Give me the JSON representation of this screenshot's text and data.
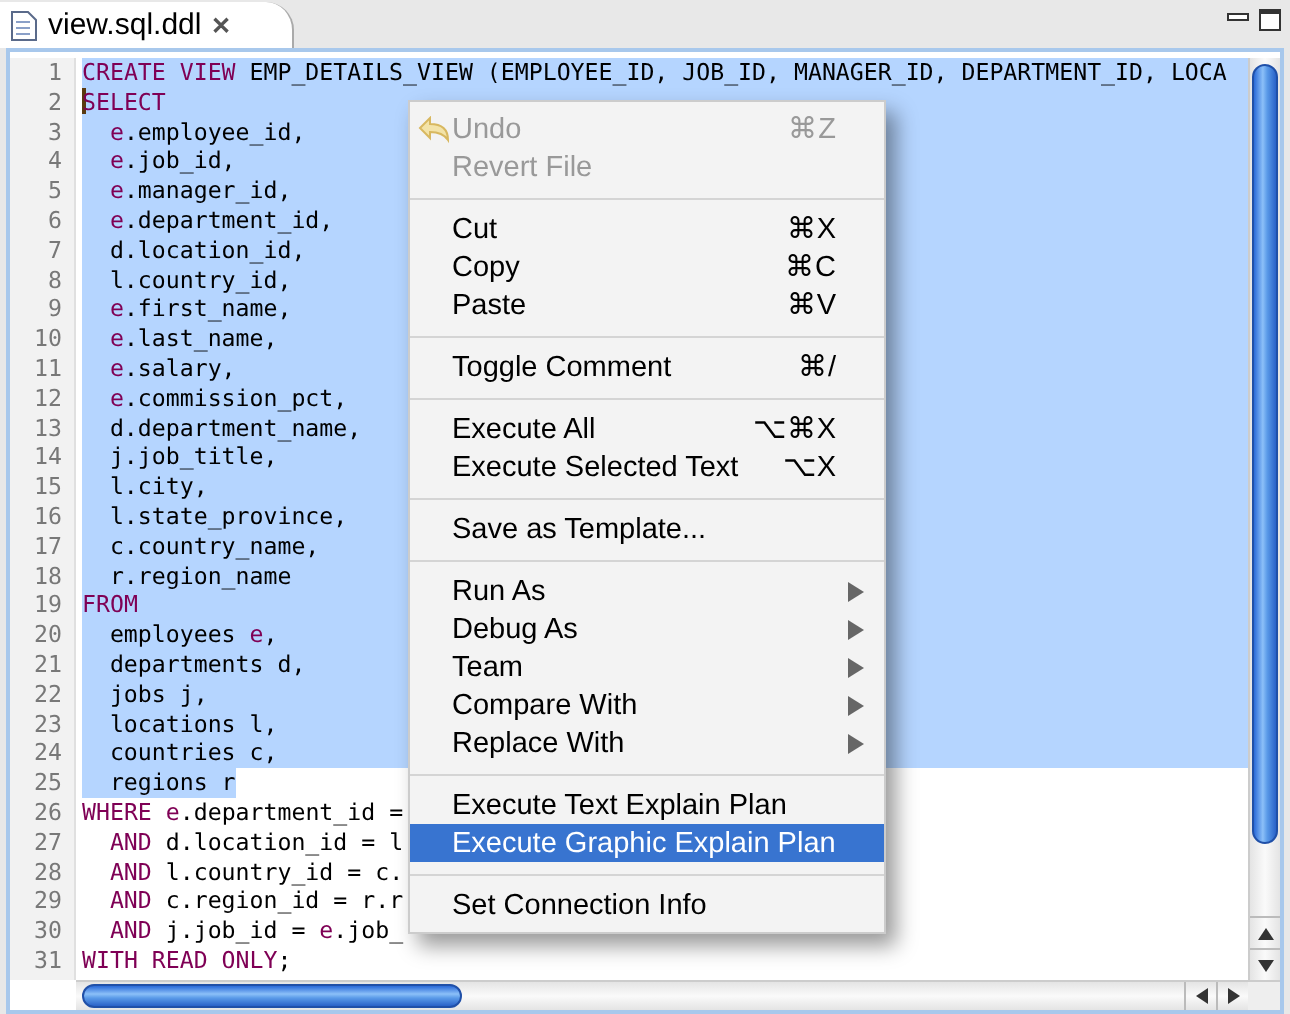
{
  "tab": {
    "title": "view.sql.ddl",
    "close": "✕"
  },
  "lines": [
    {
      "n": "1",
      "selected": true,
      "eol_selected": true,
      "indented": false,
      "tokens": [
        {
          "kind": "keyword",
          "text": "CREATE VIEW"
        },
        {
          "kind": "plain",
          "text": " EMP_DETAILS_VIEW (EMPLOYEE_ID, JOB_ID, MANAGER_ID, DEPARTMENT_ID, LOCA"
        }
      ]
    },
    {
      "n": "2",
      "selected": true,
      "eol_selected": true,
      "indented": false,
      "cursor": true,
      "tokens": [
        {
          "kind": "keyword",
          "text": "SELECT"
        }
      ]
    },
    {
      "n": "3",
      "selected": true,
      "eol_selected": true,
      "indented": true,
      "tokens": [
        {
          "kind": "alias",
          "text": "e"
        },
        {
          "kind": "plain",
          "text": ".employee_id,"
        }
      ]
    },
    {
      "n": "4",
      "selected": true,
      "eol_selected": true,
      "indented": true,
      "tokens": [
        {
          "kind": "alias",
          "text": "e"
        },
        {
          "kind": "plain",
          "text": ".job_id,"
        }
      ]
    },
    {
      "n": "5",
      "selected": true,
      "eol_selected": true,
      "indented": true,
      "tokens": [
        {
          "kind": "alias",
          "text": "e"
        },
        {
          "kind": "plain",
          "text": ".manager_id,"
        }
      ]
    },
    {
      "n": "6",
      "selected": true,
      "eol_selected": true,
      "indented": true,
      "tokens": [
        {
          "kind": "alias",
          "text": "e"
        },
        {
          "kind": "plain",
          "text": ".department_id,"
        }
      ]
    },
    {
      "n": "7",
      "selected": true,
      "eol_selected": true,
      "indented": true,
      "tokens": [
        {
          "kind": "plain",
          "text": "d.location_id,"
        }
      ]
    },
    {
      "n": "8",
      "selected": true,
      "eol_selected": true,
      "indented": true,
      "tokens": [
        {
          "kind": "plain",
          "text": "l.country_id,"
        }
      ]
    },
    {
      "n": "9",
      "selected": true,
      "eol_selected": true,
      "indented": true,
      "tokens": [
        {
          "kind": "alias",
          "text": "e"
        },
        {
          "kind": "plain",
          "text": ".first_name,"
        }
      ]
    },
    {
      "n": "10",
      "selected": true,
      "eol_selected": true,
      "indented": true,
      "tokens": [
        {
          "kind": "alias",
          "text": "e"
        },
        {
          "kind": "plain",
          "text": ".last_name,"
        }
      ]
    },
    {
      "n": "11",
      "selected": true,
      "eol_selected": true,
      "indented": true,
      "tokens": [
        {
          "kind": "alias",
          "text": "e"
        },
        {
          "kind": "plain",
          "text": ".salary,"
        }
      ]
    },
    {
      "n": "12",
      "selected": true,
      "eol_selected": true,
      "indented": true,
      "tokens": [
        {
          "kind": "alias",
          "text": "e"
        },
        {
          "kind": "plain",
          "text": ".commission_pct,"
        }
      ]
    },
    {
      "n": "13",
      "selected": true,
      "eol_selected": true,
      "indented": true,
      "tokens": [
        {
          "kind": "plain",
          "text": "d.department_name,"
        }
      ]
    },
    {
      "n": "14",
      "selected": true,
      "eol_selected": true,
      "indented": true,
      "tokens": [
        {
          "kind": "plain",
          "text": "j.job_title,"
        }
      ]
    },
    {
      "n": "15",
      "selected": true,
      "eol_selected": true,
      "indented": true,
      "tokens": [
        {
          "kind": "plain",
          "text": "l.city,"
        }
      ]
    },
    {
      "n": "16",
      "selected": true,
      "eol_selected": true,
      "indented": true,
      "tokens": [
        {
          "kind": "plain",
          "text": "l.state_province,"
        }
      ]
    },
    {
      "n": "17",
      "selected": true,
      "eol_selected": true,
      "indented": true,
      "tokens": [
        {
          "kind": "plain",
          "text": "c.country_name,"
        }
      ]
    },
    {
      "n": "18",
      "selected": true,
      "eol_selected": true,
      "indented": true,
      "tokens": [
        {
          "kind": "plain",
          "text": "r.region_name"
        }
      ]
    },
    {
      "n": "19",
      "selected": true,
      "eol_selected": true,
      "indented": false,
      "tokens": [
        {
          "kind": "keyword",
          "text": "FROM"
        }
      ]
    },
    {
      "n": "20",
      "selected": true,
      "eol_selected": true,
      "indented": true,
      "tokens": [
        {
          "kind": "plain",
          "text": "employees"
        },
        {
          "kind": "alias",
          "text": " e"
        },
        {
          "kind": "plain",
          "text": ","
        }
      ]
    },
    {
      "n": "21",
      "selected": true,
      "eol_selected": true,
      "indented": true,
      "tokens": [
        {
          "kind": "plain",
          "text": "departments d,"
        }
      ]
    },
    {
      "n": "22",
      "selected": true,
      "eol_selected": true,
      "indented": true,
      "tokens": [
        {
          "kind": "plain",
          "text": "jobs j,"
        }
      ]
    },
    {
      "n": "23",
      "selected": true,
      "eol_selected": true,
      "indented": true,
      "tokens": [
        {
          "kind": "plain",
          "text": "locations l,"
        }
      ]
    },
    {
      "n": "24",
      "selected": true,
      "eol_selected": true,
      "indented": true,
      "tokens": [
        {
          "kind": "plain",
          "text": "countries c,"
        }
      ]
    },
    {
      "n": "25",
      "selected": true,
      "eol_selected": false,
      "indented": true,
      "tokens": [
        {
          "kind": "plain",
          "text": "regions r"
        }
      ]
    },
    {
      "n": "26",
      "selected": false,
      "indented": false,
      "tokens": [
        {
          "kind": "keyword",
          "text": "WHERE"
        },
        {
          "kind": "alias",
          "text": " e"
        },
        {
          "kind": "plain",
          "text": ".department_id ="
        }
      ]
    },
    {
      "n": "27",
      "selected": false,
      "indented": true,
      "tokens": [
        {
          "kind": "keyword",
          "text": "AND"
        },
        {
          "kind": "plain",
          "text": " d.location_id = l"
        }
      ]
    },
    {
      "n": "28",
      "selected": false,
      "indented": true,
      "tokens": [
        {
          "kind": "keyword",
          "text": "AND"
        },
        {
          "kind": "plain",
          "text": " l.country_id = c."
        }
      ]
    },
    {
      "n": "29",
      "selected": false,
      "indented": true,
      "tokens": [
        {
          "kind": "keyword",
          "text": "AND"
        },
        {
          "kind": "plain",
          "text": " c.region_id = r.r"
        }
      ]
    },
    {
      "n": "30",
      "selected": false,
      "indented": true,
      "tokens": [
        {
          "kind": "keyword",
          "text": "AND"
        },
        {
          "kind": "plain",
          "text": " j.job_id ="
        },
        {
          "kind": "alias",
          "text": " e"
        },
        {
          "kind": "plain",
          "text": ".job_"
        }
      ]
    },
    {
      "n": "31",
      "selected": false,
      "indented": false,
      "tokens": [
        {
          "kind": "keyword",
          "text": "WITH READ ONLY"
        },
        {
          "kind": "plain",
          "text": ";"
        }
      ]
    }
  ],
  "context_menu": [
    {
      "kind": "item",
      "label": "Undo",
      "shortcut": "⌘Z",
      "disabled": true,
      "icon": true,
      "submenu": false,
      "selected": false
    },
    {
      "kind": "item",
      "label": "Revert File",
      "disabled": true,
      "submenu": false,
      "selected": false
    },
    {
      "kind": "separator"
    },
    {
      "kind": "item",
      "label": "Cut",
      "shortcut": "⌘X",
      "disabled": false,
      "submenu": false,
      "selected": false
    },
    {
      "kind": "item",
      "label": "Copy",
      "shortcut": "⌘C",
      "disabled": false,
      "submenu": false,
      "selected": false
    },
    {
      "kind": "item",
      "label": "Paste",
      "shortcut": "⌘V",
      "disabled": false,
      "submenu": false,
      "selected": false
    },
    {
      "kind": "separator"
    },
    {
      "kind": "item",
      "label": "Toggle Comment",
      "shortcut": "⌘/",
      "disabled": false,
      "submenu": false,
      "selected": false
    },
    {
      "kind": "separator"
    },
    {
      "kind": "item",
      "label": "Execute All",
      "shortcut": "⌥⌘X",
      "disabled": false,
      "submenu": false,
      "selected": false
    },
    {
      "kind": "item",
      "label": "Execute Selected Text",
      "shortcut": "⌥X",
      "disabled": false,
      "submenu": false,
      "selected": false
    },
    {
      "kind": "separator"
    },
    {
      "kind": "item",
      "label": "Save as Template...",
      "disabled": false,
      "submenu": false,
      "selected": false
    },
    {
      "kind": "separator"
    },
    {
      "kind": "item",
      "label": "Run As",
      "disabled": false,
      "submenu": true,
      "selected": false
    },
    {
      "kind": "item",
      "label": "Debug As",
      "disabled": false,
      "submenu": true,
      "selected": false
    },
    {
      "kind": "item",
      "label": "Team",
      "disabled": false,
      "submenu": true,
      "selected": false
    },
    {
      "kind": "item",
      "label": "Compare With",
      "disabled": false,
      "submenu": true,
      "selected": false
    },
    {
      "kind": "item",
      "label": "Replace With",
      "disabled": false,
      "submenu": true,
      "selected": false
    },
    {
      "kind": "separator"
    },
    {
      "kind": "item",
      "label": "Execute Text Explain Plan",
      "disabled": false,
      "submenu": false,
      "selected": false
    },
    {
      "kind": "item",
      "label": "Execute Graphic Explain Plan",
      "disabled": false,
      "submenu": false,
      "selected": true
    },
    {
      "kind": "separator"
    },
    {
      "kind": "item",
      "label": "Set Connection Info",
      "disabled": false,
      "submenu": false,
      "selected": false
    }
  ]
}
